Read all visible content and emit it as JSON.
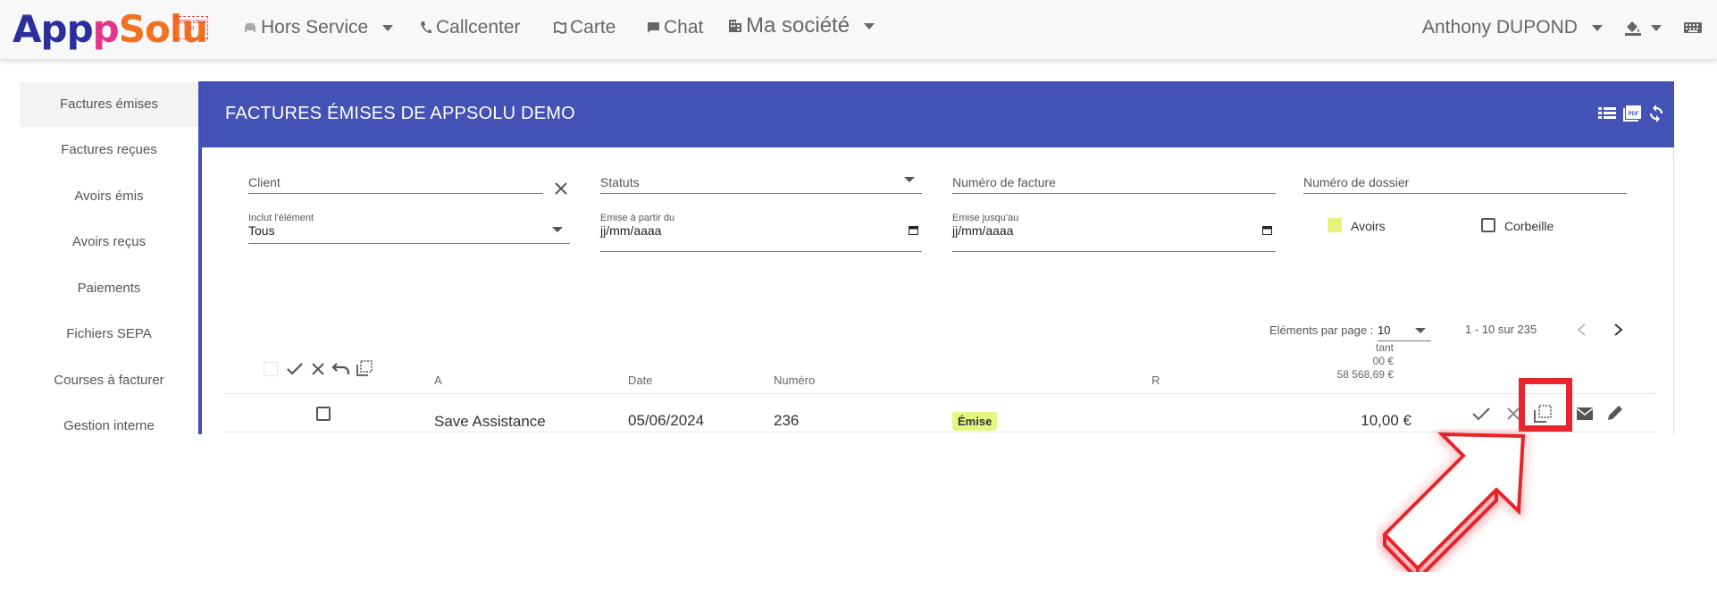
{
  "navbar": {
    "logo_part1": "App",
    "logo_part2": "p",
    "logo_part3": "Solu",
    "stamp_text": "VOTRE LOGO ICI",
    "items": [
      {
        "label": "Hors Service",
        "icon": "car-icon"
      },
      {
        "label": "Callcenter",
        "icon": "phone-icon"
      },
      {
        "label": "Carte",
        "icon": "map-icon"
      },
      {
        "label": "Chat",
        "icon": "chat-icon"
      },
      {
        "label": "Ma société",
        "icon": "building-icon"
      }
    ],
    "user": "Anthony DUPOND"
  },
  "sidebar": {
    "items": [
      {
        "label": "Factures émises"
      },
      {
        "label": "Factures reçues"
      },
      {
        "label": "Avoirs émis"
      },
      {
        "label": "Avoirs reçus"
      },
      {
        "label": "Paiements"
      },
      {
        "label": "Fichiers SEPA"
      },
      {
        "label": "Courses à facturer"
      },
      {
        "label": "Gestion interne"
      }
    ]
  },
  "panel": {
    "title": "FACTURES ÉMISES DE APPSOLU DEMO"
  },
  "filters": {
    "client": "Client",
    "statuts": "Statuts",
    "numero_facture": "Numéro de facture",
    "numero_dossier": "Numéro de dossier",
    "inclut_label": "Inclut l'élément",
    "inclut_value": "Tous",
    "emise_du_label": "Emise à partir du",
    "emise_du_value": "jj/mm/aaaa",
    "emise_au_label": "Emise jusqu'au",
    "emise_au_value": "jj/mm/aaaa",
    "avoirs": "Avoirs",
    "avoirs_checked": true,
    "corbeille": "Corbeille",
    "corbeille_checked": false
  },
  "pagination": {
    "label": "Eléments par page :",
    "per_page": "10",
    "range": "1 - 10 sur 235"
  },
  "table": {
    "headers": {
      "a": "A",
      "date": "Date",
      "numero": "Numéro",
      "r": "R",
      "montant_line1": "tant",
      "montant_line2": "00 €",
      "montant_line3": "58 568,69 €"
    },
    "rows": [
      {
        "client": "Save Assistance",
        "date": "05/06/2024",
        "numero": "236",
        "statut": "Émise",
        "montant": "10,00 €"
      }
    ]
  },
  "colors": {
    "primary": "#4352b4",
    "badge": "#e6f582",
    "highlight": "#e8242c"
  }
}
